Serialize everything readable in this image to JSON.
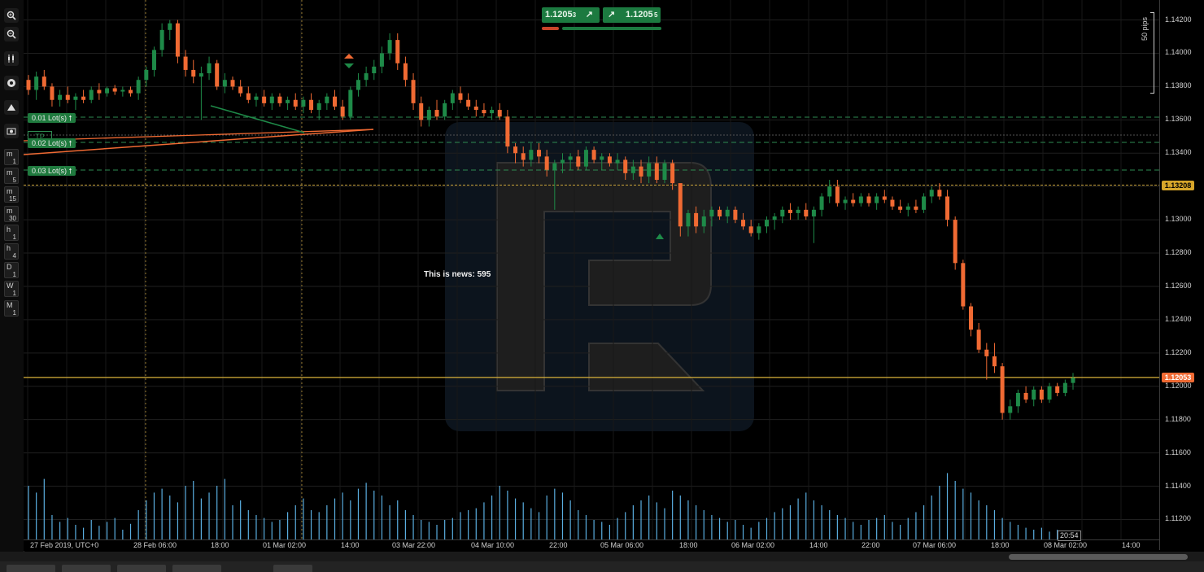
{
  "trade_panel": {
    "sell_price": "1.1205",
    "sell_price_suffix": "3",
    "buy_price": "1.1205",
    "buy_price_suffix": "5"
  },
  "lots": [
    {
      "label": "0.01 Lot(s) 🠕",
      "price": 1.1369
    },
    {
      "label": "0.02 Lot(s) 🠕",
      "price": 1.1353
    },
    {
      "label": "0.03 Lot(s) 🠕",
      "price": 1.1336
    }
  ],
  "tp_label": "TP",
  "news_label": "This is news: 595",
  "pips_label": "50 pips",
  "time_badge": "20:54",
  "price_ticks": [
    "1.14200",
    "1.14000",
    "1.13800",
    "1.13600",
    "1.13400",
    "1.13200",
    "1.13000",
    "1.12800",
    "1.12600",
    "1.12400",
    "1.12200",
    "1.12000",
    "1.11800",
    "1.11600",
    "1.11400",
    "1.11200"
  ],
  "price_badges": {
    "horizontal_line": "1.13208",
    "current": "1.12053"
  },
  "time_ticks": [
    "27 Feb 2019, UTC+0",
    "28 Feb 06:00",
    "18:00",
    "01 Mar 02:00",
    "14:00",
    "03 Mar 22:00",
    "04 Mar 10:00",
    "22:00",
    "05 Mar 06:00",
    "18:00",
    "06 Mar 02:00",
    "14:00",
    "22:00",
    "07 Mar 06:00",
    "18:00",
    "08 Mar 02:00",
    "14:00"
  ],
  "toolbar": {
    "timeframes": [
      {
        "top": "m",
        "bottom": "1"
      },
      {
        "top": "m",
        "bottom": "5"
      },
      {
        "top": "m",
        "bottom": "15"
      },
      {
        "top": "m",
        "bottom": "30"
      },
      {
        "top": "h",
        "bottom": "1"
      },
      {
        "top": "h",
        "bottom": "4"
      },
      {
        "top": "D",
        "bottom": "1"
      },
      {
        "top": "W",
        "bottom": "1"
      },
      {
        "top": "M",
        "bottom": "1"
      }
    ],
    "tools": [
      "zoom-in-icon",
      "zoom-out-icon",
      "indicators-icon",
      "templates-icon",
      "drawing-icon",
      "screenshot-icon"
    ]
  },
  "colors": {
    "up": "#1e8a48",
    "down": "#f06a33",
    "volume": "#5aaee0",
    "h_line": "#c8a23a",
    "current_line": "#d9b23a"
  },
  "chart_data": {
    "type": "candlestick",
    "symbol_info": "27 Feb 2019, UTC+0",
    "ylim": [
      1.1108,
      1.1432
    ],
    "candles": [
      [
        1.1384,
        1.1387,
        1.1375,
        1.1378
      ],
      [
        1.1378,
        1.1389,
        1.1372,
        1.1386
      ],
      [
        1.1386,
        1.139,
        1.1378,
        1.138
      ],
      [
        1.138,
        1.1382,
        1.1368,
        1.1372
      ],
      [
        1.1372,
        1.1378,
        1.1368,
        1.1375
      ],
      [
        1.1375,
        1.138,
        1.137,
        1.1372
      ],
      [
        1.1372,
        1.1376,
        1.1366,
        1.1374
      ],
      [
        1.1374,
        1.1378,
        1.137,
        1.1372
      ],
      [
        1.1372,
        1.138,
        1.137,
        1.1378
      ],
      [
        1.1378,
        1.1382,
        1.1372,
        1.1376
      ],
      [
        1.1376,
        1.138,
        1.1374,
        1.1379
      ],
      [
        1.1379,
        1.1381,
        1.1375,
        1.1377
      ],
      [
        1.1377,
        1.138,
        1.1374,
        1.1378
      ],
      [
        1.1378,
        1.138,
        1.1374,
        1.1376
      ],
      [
        1.1376,
        1.1386,
        1.1372,
        1.1384
      ],
      [
        1.1384,
        1.1392,
        1.138,
        1.139
      ],
      [
        1.139,
        1.1404,
        1.1386,
        1.1402
      ],
      [
        1.1402,
        1.1418,
        1.1398,
        1.1414
      ],
      [
        1.1414,
        1.142,
        1.1408,
        1.1418
      ],
      [
        1.1418,
        1.142,
        1.1394,
        1.1398
      ],
      [
        1.1398,
        1.1402,
        1.1386,
        1.139
      ],
      [
        1.139,
        1.1396,
        1.1382,
        1.1386
      ],
      [
        1.1386,
        1.1392,
        1.136,
        1.1388
      ],
      [
        1.1388,
        1.1398,
        1.1384,
        1.1394
      ],
      [
        1.1394,
        1.1396,
        1.1378,
        1.138
      ],
      [
        1.138,
        1.1388,
        1.1376,
        1.1384
      ],
      [
        1.1384,
        1.1386,
        1.1378,
        1.138
      ],
      [
        1.138,
        1.1384,
        1.1374,
        1.1376
      ],
      [
        1.1376,
        1.138,
        1.137,
        1.1372
      ],
      [
        1.1372,
        1.1376,
        1.1368,
        1.1374
      ],
      [
        1.1374,
        1.1378,
        1.1368,
        1.137
      ],
      [
        1.137,
        1.1376,
        1.1366,
        1.1374
      ],
      [
        1.1374,
        1.1376,
        1.1368,
        1.137
      ],
      [
        1.137,
        1.1374,
        1.1366,
        1.1372
      ],
      [
        1.1372,
        1.1376,
        1.1366,
        1.1368
      ],
      [
        1.1368,
        1.1374,
        1.1364,
        1.1372
      ],
      [
        1.1372,
        1.1376,
        1.1364,
        1.1366
      ],
      [
        1.1366,
        1.1372,
        1.136,
        1.137
      ],
      [
        1.137,
        1.1376,
        1.1366,
        1.1374
      ],
      [
        1.1374,
        1.1378,
        1.1366,
        1.1368
      ],
      [
        1.1368,
        1.1372,
        1.136,
        1.1362
      ],
      [
        1.1362,
        1.138,
        1.136,
        1.1378
      ],
      [
        1.1378,
        1.1388,
        1.1374,
        1.1384
      ],
      [
        1.1384,
        1.1392,
        1.138,
        1.1388
      ],
      [
        1.1388,
        1.1396,
        1.1384,
        1.1392
      ],
      [
        1.1392,
        1.1404,
        1.1388,
        1.14
      ],
      [
        1.14,
        1.1412,
        1.1396,
        1.1408
      ],
      [
        1.1408,
        1.1412,
        1.139,
        1.1394
      ],
      [
        1.1394,
        1.1398,
        1.138,
        1.1384
      ],
      [
        1.1384,
        1.1388,
        1.1366,
        1.137
      ],
      [
        1.137,
        1.1374,
        1.1356,
        1.136
      ],
      [
        1.136,
        1.1368,
        1.1356,
        1.1366
      ],
      [
        1.1366,
        1.1372,
        1.136,
        1.1362
      ],
      [
        1.1362,
        1.1372,
        1.136,
        1.137
      ],
      [
        1.137,
        1.1378,
        1.1366,
        1.1376
      ],
      [
        1.1376,
        1.138,
        1.137,
        1.1372
      ],
      [
        1.1372,
        1.1376,
        1.1366,
        1.1368
      ],
      [
        1.1368,
        1.1372,
        1.1362,
        1.1366
      ],
      [
        1.1366,
        1.137,
        1.1362,
        1.1364
      ],
      [
        1.1364,
        1.1368,
        1.136,
        1.1366
      ],
      [
        1.1366,
        1.137,
        1.136,
        1.1362
      ],
      [
        1.1362,
        1.1366,
        1.134,
        1.1344
      ],
      [
        1.1344,
        1.1346,
        1.1334,
        1.134
      ],
      [
        1.134,
        1.1344,
        1.1332,
        1.1336
      ],
      [
        1.1336,
        1.1346,
        1.1332,
        1.1342
      ],
      [
        1.1342,
        1.1346,
        1.1334,
        1.1338
      ],
      [
        1.1338,
        1.1342,
        1.1326,
        1.133
      ],
      [
        1.133,
        1.1336,
        1.1306,
        1.1334
      ],
      [
        1.1334,
        1.134,
        1.1328,
        1.1336
      ],
      [
        1.1336,
        1.134,
        1.133,
        1.1338
      ],
      [
        1.1338,
        1.1342,
        1.133,
        1.1332
      ],
      [
        1.1332,
        1.1344,
        1.133,
        1.1342
      ],
      [
        1.1342,
        1.1344,
        1.1334,
        1.1336
      ],
      [
        1.1336,
        1.134,
        1.133,
        1.1338
      ],
      [
        1.1338,
        1.134,
        1.1332,
        1.1334
      ],
      [
        1.1334,
        1.134,
        1.133,
        1.1336
      ],
      [
        1.1336,
        1.1338,
        1.1324,
        1.1328
      ],
      [
        1.1328,
        1.1336,
        1.1324,
        1.1332
      ],
      [
        1.1332,
        1.1336,
        1.1322,
        1.1326
      ],
      [
        1.1326,
        1.1338,
        1.1322,
        1.1334
      ],
      [
        1.1334,
        1.1338,
        1.1322,
        1.1324
      ],
      [
        1.1324,
        1.1336,
        1.1322,
        1.1334
      ],
      [
        1.1334,
        1.1336,
        1.1318,
        1.1322
      ],
      [
        1.1322,
        1.1308,
        1.129,
        1.1296
      ],
      [
        1.1296,
        1.1306,
        1.129,
        1.1304
      ],
      [
        1.1304,
        1.1308,
        1.1292,
        1.1296
      ],
      [
        1.1296,
        1.1306,
        1.1292,
        1.1302
      ],
      [
        1.1302,
        1.1308,
        1.1296,
        1.1306
      ],
      [
        1.1306,
        1.1308,
        1.13,
        1.1302
      ],
      [
        1.1302,
        1.1308,
        1.1298,
        1.1306
      ],
      [
        1.1306,
        1.1308,
        1.1298,
        1.13
      ],
      [
        1.13,
        1.1304,
        1.1294,
        1.1296
      ],
      [
        1.1296,
        1.13,
        1.129,
        1.1292
      ],
      [
        1.1292,
        1.1298,
        1.1288,
        1.1296
      ],
      [
        1.1296,
        1.1302,
        1.1292,
        1.13
      ],
      [
        1.13,
        1.1304,
        1.1294,
        1.1302
      ],
      [
        1.1302,
        1.1308,
        1.1298,
        1.1306
      ],
      [
        1.1306,
        1.131,
        1.13,
        1.1304
      ],
      [
        1.1304,
        1.1308,
        1.13,
        1.1306
      ],
      [
        1.1306,
        1.131,
        1.13,
        1.1302
      ],
      [
        1.1302,
        1.1308,
        1.1286,
        1.1306
      ],
      [
        1.1306,
        1.1316,
        1.1302,
        1.1314
      ],
      [
        1.1314,
        1.1324,
        1.131,
        1.132
      ],
      [
        1.132,
        1.1324,
        1.1308,
        1.131
      ],
      [
        1.131,
        1.1314,
        1.1306,
        1.1312
      ],
      [
        1.1312,
        1.1316,
        1.1308,
        1.131
      ],
      [
        1.131,
        1.1316,
        1.1308,
        1.1314
      ],
      [
        1.1314,
        1.1316,
        1.1308,
        1.131
      ],
      [
        1.131,
        1.1316,
        1.1306,
        1.1314
      ],
      [
        1.1314,
        1.1318,
        1.131,
        1.1312
      ],
      [
        1.1312,
        1.1314,
        1.1306,
        1.1308
      ],
      [
        1.1308,
        1.1312,
        1.1304,
        1.1306
      ],
      [
        1.1306,
        1.131,
        1.1302,
        1.1308
      ],
      [
        1.1308,
        1.1312,
        1.1304,
        1.1306
      ],
      [
        1.1306,
        1.1316,
        1.1304,
        1.1314
      ],
      [
        1.1314,
        1.132,
        1.131,
        1.1318
      ],
      [
        1.1318,
        1.1322,
        1.1312,
        1.1314
      ],
      [
        1.1314,
        1.1318,
        1.1296,
        1.13
      ],
      [
        1.13,
        1.1302,
        1.127,
        1.1274
      ],
      [
        1.1274,
        1.1276,
        1.1246,
        1.1248
      ],
      [
        1.1248,
        1.125,
        1.123,
        1.1234
      ],
      [
        1.1234,
        1.1238,
        1.122,
        1.1222
      ],
      [
        1.1222,
        1.1226,
        1.1204,
        1.1218
      ],
      [
        1.1218,
        1.1226,
        1.1208,
        1.1212
      ],
      [
        1.1212,
        1.1214,
        1.118,
        1.1184
      ],
      [
        1.1184,
        1.1192,
        1.118,
        1.1188
      ],
      [
        1.1188,
        1.1198,
        1.1184,
        1.1196
      ],
      [
        1.1196,
        1.12,
        1.119,
        1.1192
      ],
      [
        1.1192,
        1.12,
        1.1188,
        1.1198
      ],
      [
        1.1198,
        1.12,
        1.119,
        1.1192
      ],
      [
        1.1192,
        1.1202,
        1.119,
        1.12
      ],
      [
        1.12,
        1.1202,
        1.1194,
        1.1196
      ],
      [
        1.1196,
        1.1204,
        1.1194,
        1.1202
      ],
      [
        1.1202,
        1.1208,
        1.1198,
        1.1205
      ]
    ],
    "volumes": [
      0.55,
      0.48,
      0.62,
      0.25,
      0.18,
      0.22,
      0.15,
      0.12,
      0.2,
      0.14,
      0.18,
      0.22,
      0.1,
      0.16,
      0.3,
      0.4,
      0.48,
      0.52,
      0.45,
      0.38,
      0.55,
      0.6,
      0.42,
      0.48,
      0.55,
      0.62,
      0.35,
      0.4,
      0.3,
      0.25,
      0.22,
      0.18,
      0.2,
      0.28,
      0.35,
      0.42,
      0.3,
      0.28,
      0.35,
      0.42,
      0.48,
      0.4,
      0.52,
      0.58,
      0.5,
      0.45,
      0.35,
      0.4,
      0.3,
      0.25,
      0.2,
      0.18,
      0.15,
      0.2,
      0.22,
      0.28,
      0.3,
      0.32,
      0.38,
      0.45,
      0.55,
      0.5,
      0.42,
      0.38,
      0.32,
      0.28,
      0.45,
      0.52,
      0.48,
      0.4,
      0.3,
      0.25,
      0.2,
      0.18,
      0.15,
      0.22,
      0.28,
      0.35,
      0.4,
      0.45,
      0.38,
      0.32,
      0.5,
      0.45,
      0.4,
      0.35,
      0.3,
      0.25,
      0.22,
      0.18,
      0.2,
      0.15,
      0.12,
      0.18,
      0.22,
      0.28,
      0.32,
      0.35,
      0.42,
      0.48,
      0.4,
      0.35,
      0.3,
      0.25,
      0.22,
      0.18,
      0.15,
      0.2,
      0.22,
      0.25,
      0.18,
      0.15,
      0.22,
      0.28,
      0.35,
      0.45,
      0.55,
      0.68,
      0.6,
      0.52,
      0.48,
      0.4,
      0.35,
      0.3,
      0.22,
      0.18,
      0.15,
      0.12,
      0.1,
      0.12,
      0.08,
      0.1
    ],
    "horizontal_line": 1.13208,
    "current_price": 1.12053
  }
}
